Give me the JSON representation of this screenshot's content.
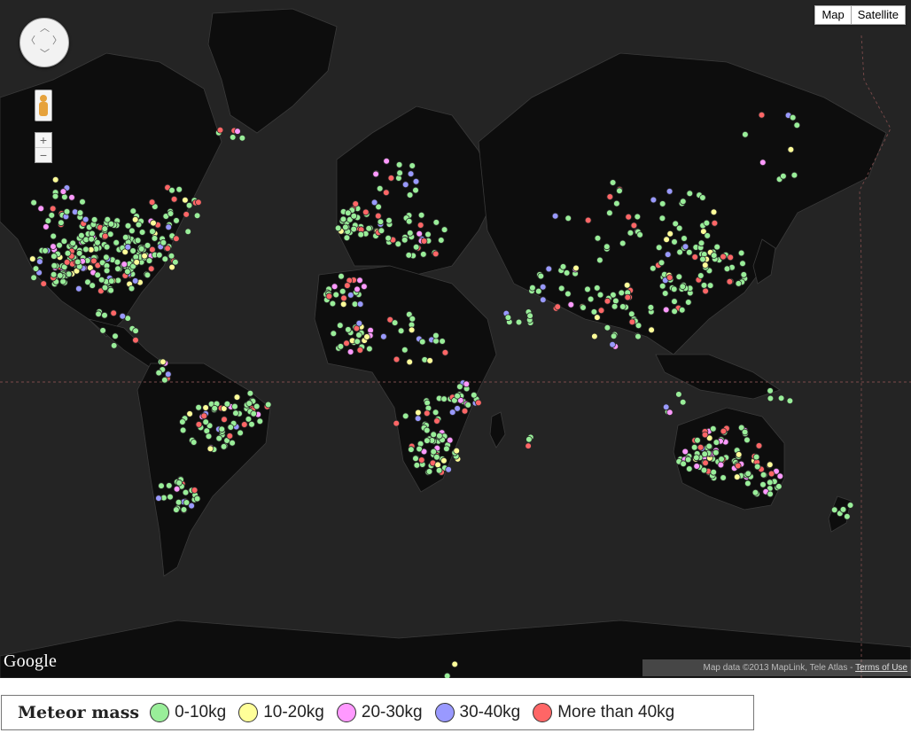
{
  "map_type_buttons": {
    "map": "Map",
    "satellite": "Satellite"
  },
  "zoom": {
    "in": "+",
    "out": "−"
  },
  "google_logo": "Google",
  "attribution": {
    "text": "Map data ©2013 MapLink, Tele Atlas - ",
    "terms": "Terms of Use"
  },
  "legend": {
    "title": "Meteor mass",
    "items": [
      {
        "label": "0-10kg",
        "color": "#99ee99"
      },
      {
        "label": "10-20kg",
        "color": "#ffff99"
      },
      {
        "label": "20-30kg",
        "color": "#ff99ff"
      },
      {
        "label": "30-40kg",
        "color": "#9999ff"
      },
      {
        "label": "More than 40kg",
        "color": "#ff6666"
      }
    ]
  },
  "colors": {
    "ocean": "#242424",
    "land": "#0d0d0d",
    "grid": "#7b4a4a"
  }
}
